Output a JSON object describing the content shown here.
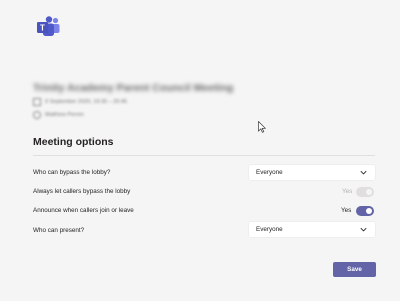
{
  "app": {
    "logo_icon": "microsoft-teams-logo-icon",
    "brand_color": "#6264a7"
  },
  "meeting": {
    "title": "Trinity Academy Parent Council Meeting",
    "date_icon": "calendar-icon",
    "datetime": "9 September 2020, 19:30 – 20:45",
    "organizer_icon": "person-icon",
    "organizer": "Matthew Perren"
  },
  "options": {
    "heading": "Meeting options",
    "bypass_lobby": {
      "label": "Who can bypass the lobby?",
      "value": "Everyone"
    },
    "callers_bypass": {
      "label": "Always let callers bypass the lobby",
      "state": "Yes",
      "enabled": false,
      "on": true
    },
    "announce": {
      "label": "Announce when callers join or leave",
      "state": "Yes",
      "enabled": true,
      "on": true
    },
    "presenters": {
      "label": "Who can present?",
      "value": "Everyone"
    }
  },
  "actions": {
    "save_label": "Save"
  }
}
